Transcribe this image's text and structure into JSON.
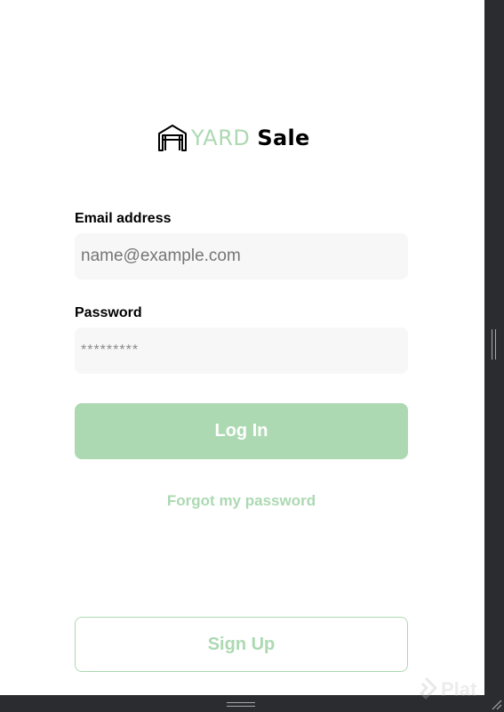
{
  "logo": {
    "icon": "garage-icon",
    "word_1": "YARD",
    "word_2": "Sale"
  },
  "form": {
    "email_label": "Email address",
    "email_placeholder": "name@example.com",
    "password_label": "Password",
    "password_value": "*********",
    "login_label": "Log In",
    "forgot_label": "Forgot my password"
  },
  "signup": {
    "label": "Sign Up"
  },
  "watermark": {
    "text": "Plat"
  },
  "colors": {
    "accent": "#acd9b2",
    "input_bg": "#f7f7f7",
    "frame": "#2b2c30"
  }
}
